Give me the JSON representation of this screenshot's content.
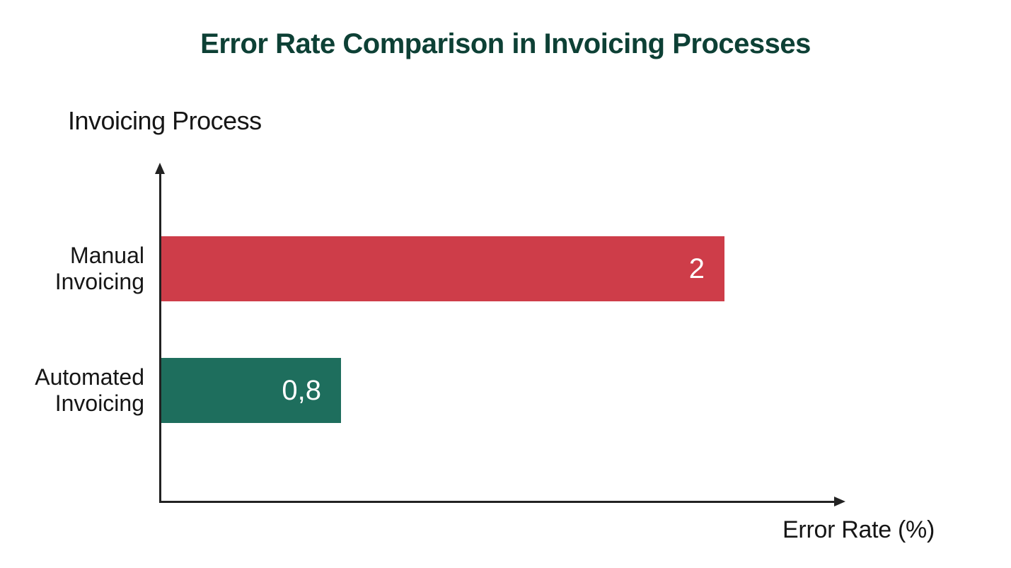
{
  "title": "Error Rate Comparison in Invoicing Processes",
  "y_axis_title": "Invoicing Process",
  "x_axis_title": "Error Rate (%)",
  "bars": [
    {
      "label_line1": "Manual",
      "label_line2": "Invoicing",
      "value_label": "2"
    },
    {
      "label_line1": "Automated",
      "label_line2": "Invoicing",
      "value_label": "0,8"
    }
  ],
  "colors": {
    "manual": "#ce3d49",
    "automated": "#1e6e5d",
    "title": "#0d4035",
    "text": "#161616"
  },
  "chart_data": {
    "type": "bar",
    "orientation": "horizontal",
    "title": "Error Rate Comparison in Invoicing Processes",
    "xlabel": "Error Rate (%)",
    "ylabel": "Invoicing Process",
    "categories": [
      "Manual Invoicing",
      "Automated Invoicing"
    ],
    "values": [
      2,
      0.8
    ],
    "colors": [
      "#ce3d49",
      "#1e6e5d"
    ],
    "xlim": [
      0,
      2.5
    ]
  }
}
